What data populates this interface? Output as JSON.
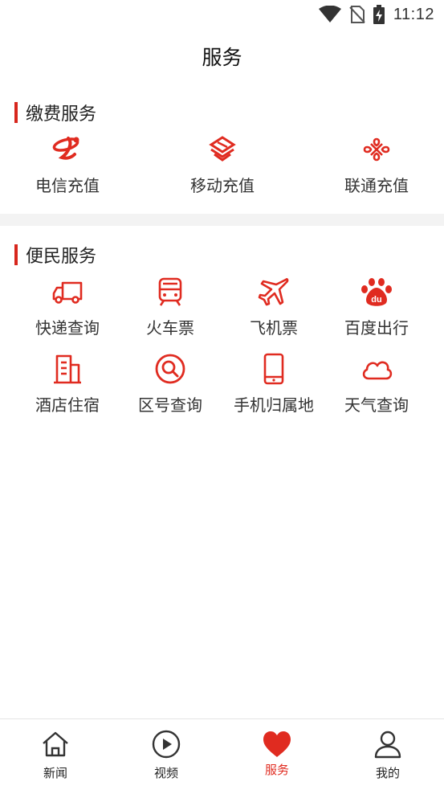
{
  "status_bar": {
    "time": "11:12",
    "icons": [
      "wifi-icon",
      "no-sim-icon",
      "battery-charging-icon"
    ]
  },
  "header": {
    "title": "服务"
  },
  "sections": [
    {
      "title": "缴费服务",
      "items": [
        {
          "label": "电信充值",
          "icon": "china-telecom-icon"
        },
        {
          "label": "移动充值",
          "icon": "china-mobile-icon"
        },
        {
          "label": "联通充值",
          "icon": "china-unicom-icon"
        }
      ]
    },
    {
      "title": "便民服务",
      "items": [
        {
          "label": "快递查询",
          "icon": "truck-icon"
        },
        {
          "label": "火车票",
          "icon": "train-icon"
        },
        {
          "label": "飞机票",
          "icon": "airplane-icon"
        },
        {
          "label": "百度出行",
          "icon": "baidu-paw-icon"
        },
        {
          "label": "酒店住宿",
          "icon": "building-icon"
        },
        {
          "label": "区号查询",
          "icon": "magnifier-icon"
        },
        {
          "label": "手机归属地",
          "icon": "phone-icon"
        },
        {
          "label": "天气查询",
          "icon": "cloud-icon"
        }
      ]
    }
  ],
  "tabbar": {
    "tabs": [
      {
        "label": "新闻",
        "icon": "home-icon",
        "active": false
      },
      {
        "label": "视频",
        "icon": "play-circle-icon",
        "active": false
      },
      {
        "label": "服务",
        "icon": "heart-icon",
        "active": true
      },
      {
        "label": "我的",
        "icon": "user-icon",
        "active": false
      }
    ]
  },
  "colors": {
    "accent": "#e02b20",
    "section_bar": "#d7261d",
    "divider": "#f3f3f3",
    "text": "#333333"
  }
}
